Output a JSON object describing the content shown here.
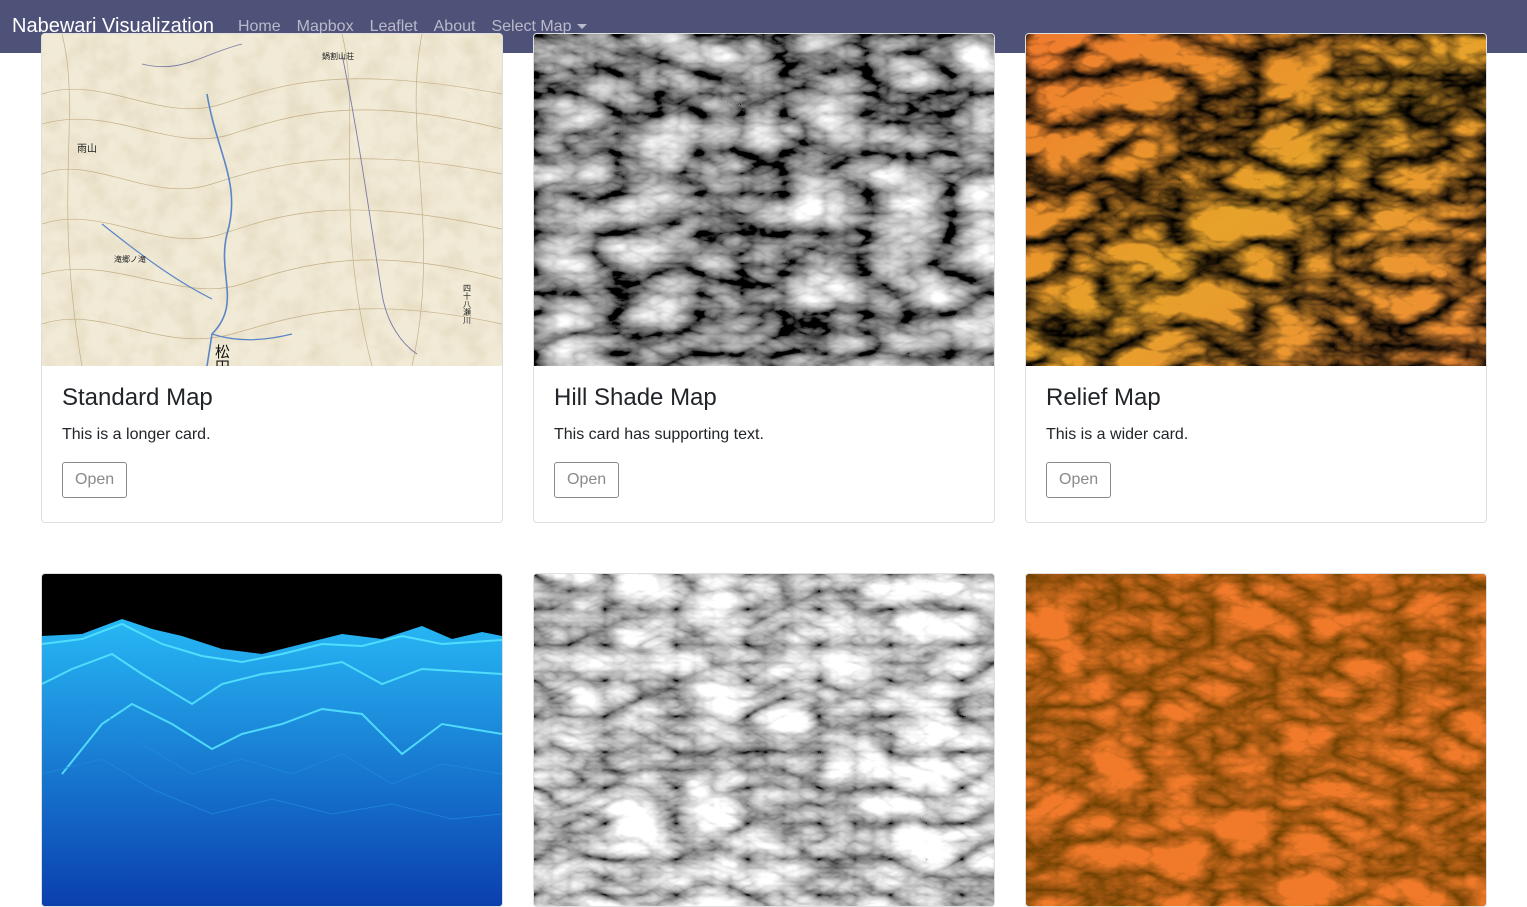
{
  "navbar": {
    "brand": "Nabewari Visualization",
    "links": [
      "Home",
      "Mapbox",
      "Leaflet",
      "About"
    ],
    "dropdown_label": "Select Map",
    "background": "#4e5178"
  },
  "cards": [
    {
      "title": "Standard Map",
      "text": "This is a longer card.",
      "button": "Open",
      "image": "topographic-map"
    },
    {
      "title": "Hill Shade Map",
      "text": "This card has supporting text.",
      "button": "Open",
      "image": "hillshade-map"
    },
    {
      "title": "Relief Map",
      "text": "This is a wider card.",
      "button": "Open",
      "image": "relief-map"
    },
    {
      "image": "3d-wireframe-terrain"
    },
    {
      "image": "hillshade-map"
    },
    {
      "image": "orange-relief-map"
    }
  ],
  "map_labels": {
    "mountain": "雨山",
    "waterfall": "滝郷ノ滝",
    "river": "四十八瀬川",
    "lodge": "鍋割山荘",
    "town": "松田町"
  }
}
